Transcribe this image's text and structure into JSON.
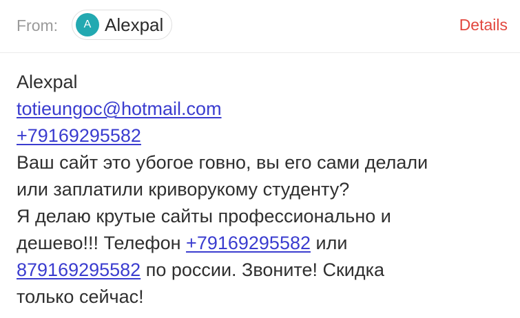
{
  "header": {
    "from_label": "From:",
    "sender": {
      "avatar_initial": "A",
      "avatar_color": "#23a9b1",
      "name": "Alexpal"
    },
    "details_label": "Details",
    "details_color": "#e2473e"
  },
  "message": {
    "name_line": "Alexpal",
    "email": "totieungoc@hotmail.com",
    "phone": "+79169295582",
    "text_1": "Ваш сайт это убогое говно, вы его сами делали",
    "text_2": "или заплатили криворукому студенту?",
    "text_3": "Я делаю крутые сайты профессионально и",
    "text_4_before": "дешево!!! Телефон",
    "text_4_link": "+79169295582",
    "text_4_after": "или",
    "text_5_link": "879169295582",
    "text_5_after": "по россии. Звоните! Скидка",
    "text_6": "только сейчас!",
    "link_color": "#3a3ccf"
  }
}
